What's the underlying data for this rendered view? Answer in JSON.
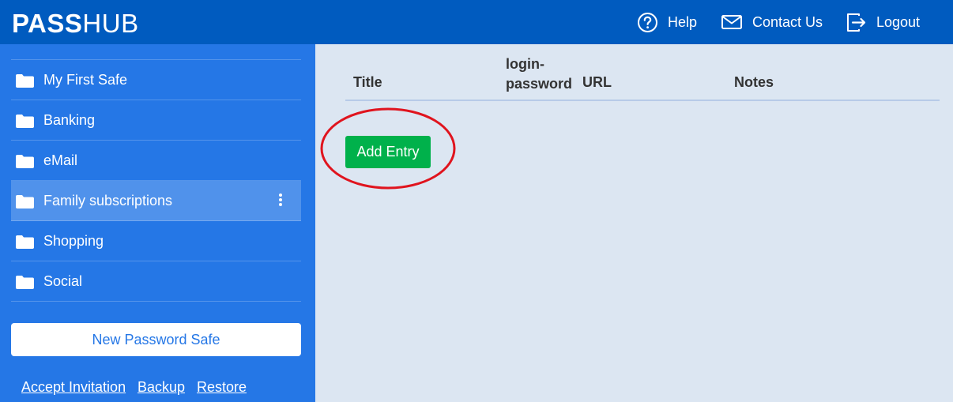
{
  "header": {
    "logo_bold": "PASS",
    "logo_light": "HUB",
    "help": "Help",
    "contact": "Contact Us",
    "logout": "Logout"
  },
  "sidebar": {
    "safes": [
      {
        "label": "My First Safe"
      },
      {
        "label": "Banking"
      },
      {
        "label": "eMail"
      },
      {
        "label": "Family subscriptions"
      },
      {
        "label": "Shopping"
      },
      {
        "label": "Social"
      }
    ],
    "new_safe": "New Password Safe",
    "links": {
      "accept": "Accept Invitation",
      "backup": "Backup",
      "restore": "Restore"
    }
  },
  "table": {
    "headers": {
      "title": "Title",
      "login_line1": "login-",
      "login_line2": "password",
      "url": "URL",
      "notes": "Notes"
    }
  },
  "actions": {
    "add_entry": "Add Entry"
  },
  "colors": {
    "header_bg": "#005bbf",
    "sidebar_bg": "#2577e6",
    "content_bg": "#dce6f2",
    "add_button": "#00b14b",
    "annotation": "#e0141e"
  }
}
